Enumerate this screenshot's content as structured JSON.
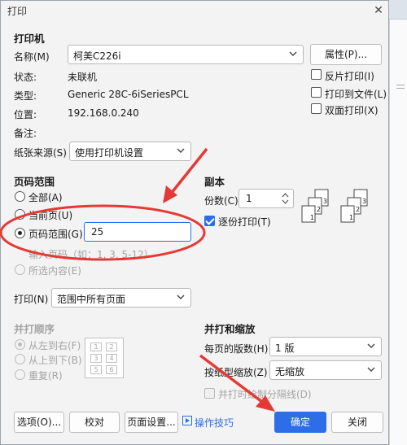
{
  "window": {
    "title": "打印"
  },
  "printer": {
    "section": "打印机",
    "name_label": "名称(M)",
    "name_value": "柯美C226i",
    "properties_button": "属性(P)...",
    "status_label": "状态:",
    "status_value": "未联机",
    "type_label": "类型:",
    "type_value": "Generic 28C-6iSeriesPCL",
    "location_label": "位置:",
    "location_value": "192.168.0.240",
    "comment_label": "备注:",
    "paper_source_label": "纸张来源(S)",
    "paper_source_value": "使用打印机设置",
    "reverse_print": "反片打印(I)",
    "print_to_file": "打印到文件(L)",
    "duplex": "双面打印(X)"
  },
  "page_range": {
    "section": "页码范围",
    "all": "全部(A)",
    "current": "当前页(U)",
    "range": "页码范围(G)",
    "range_value": "25",
    "hint": "输入页码（如：1, 3, 5-12）",
    "selection": "所选内容(E)"
  },
  "copies": {
    "section": "副本",
    "count_label": "份数(C)",
    "count_value": "1",
    "collate": "逐份打印(T)",
    "collate_checked": true,
    "stack_a": [
      "3",
      "2",
      "1"
    ],
    "stack_b": [
      "3",
      "2",
      "1"
    ]
  },
  "print_what": {
    "label": "打印(N)",
    "value": "范围中所有页面"
  },
  "order": {
    "section": "并打顺序",
    "left_right": "从左到右(F)",
    "top_bottom": "从上到下(B)",
    "repeat": "重复(R)",
    "grid": [
      "1",
      "2",
      "3",
      "4",
      "5",
      "6"
    ]
  },
  "zoom": {
    "section": "并打和缩放",
    "pages_per_sheet_label": "每页的版数(H)",
    "pages_per_sheet_value": "1 版",
    "scale_label": "按纸型缩放(Z)",
    "scale_value": "无缩放",
    "draw_borders": "并打时绘制分隔线(D)"
  },
  "footer": {
    "options": "选项(O)...",
    "proof": "校对",
    "page_setup": "页面设置...",
    "tips": "操作技巧",
    "ok": "确定",
    "close": "关闭"
  },
  "colors": {
    "accent": "#2d6ee8",
    "annotation": "#e53935"
  }
}
